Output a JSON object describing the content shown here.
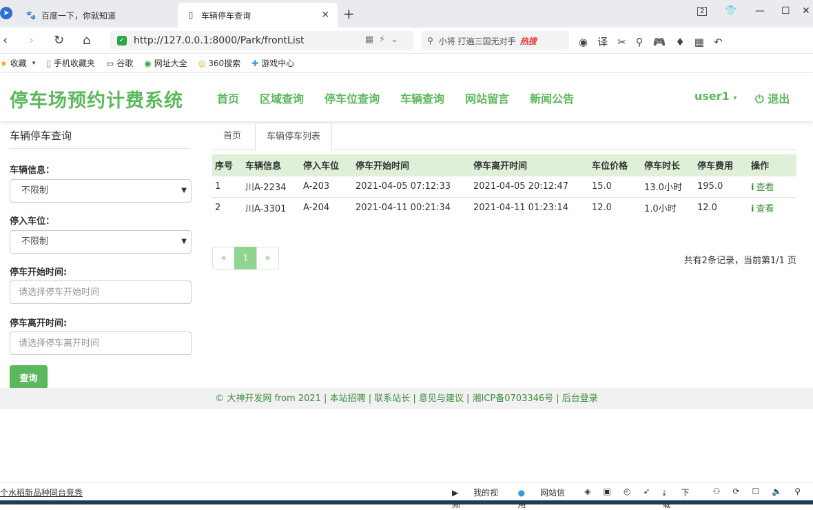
{
  "browser": {
    "tabs": [
      {
        "title": "百度一下，你就知道"
      },
      {
        "title": "车辆停车查询"
      }
    ],
    "url": "http://127.0.0.1:8000/Park/frontList",
    "search_placeholder": "小将 打遍三国无对手",
    "search_hot": "热搜",
    "window_badge": "2",
    "bookmarks": [
      {
        "label": "收藏",
        "icon": "star-icon"
      },
      {
        "label": "手机收藏夹",
        "icon": "phone-icon"
      },
      {
        "label": "谷歌",
        "icon": "page-icon"
      },
      {
        "label": "网址大全",
        "icon": "globe-icon"
      },
      {
        "label": "360搜索",
        "icon": "search-icon"
      },
      {
        "label": "游戏中心",
        "icon": "game-icon"
      }
    ]
  },
  "site": {
    "title": "停车场预约计费系统",
    "menu": [
      "首页",
      "区域查询",
      "停车位查询",
      "车辆查询",
      "网站留言",
      "新闻公告"
    ],
    "user": "user1",
    "logout": "退出"
  },
  "sidebar": {
    "title": "车辆停车查询",
    "vehicle_label": "车辆信息：",
    "vehicle_value": "不限制",
    "spot_label": "停入车位：",
    "spot_value": "不限制",
    "start_label": "停车开始时间:",
    "start_placeholder": "请选择停车开始时间",
    "end_label": "停车离开时间:",
    "end_placeholder": "请选择停车离开时间",
    "query_button": "查询"
  },
  "content": {
    "tab_home": "首页",
    "tab_active": "车辆停车列表",
    "columns": [
      "序号",
      "车辆信息",
      "停入车位",
      "停车开始时间",
      "停车离开时间",
      "车位价格",
      "停车时长",
      "停车费用",
      "操作"
    ],
    "rows": [
      {
        "no": "1",
        "vehicle": "川A-2234",
        "spot": "A-203",
        "start": "2021-04-05 07:12:33",
        "end": "2021-04-05 20:12:47",
        "price": "15.0",
        "duration": "13.0小时",
        "fee": "195.0",
        "action": "查看"
      },
      {
        "no": "2",
        "vehicle": "川A-3301",
        "spot": "A-204",
        "start": "2021-04-11 00:21:34",
        "end": "2021-04-11 01:23:14",
        "price": "12.0",
        "duration": "1.0小时",
        "fee": "12.0",
        "action": "查看"
      }
    ],
    "pager": {
      "prev": "«",
      "current": "1",
      "next": "»"
    },
    "page_info": "共有2条记录，当前第1/1 页"
  },
  "footer": {
    "text": "© 大神开发网 from 2021 | 本站招聘 | 联系站长 | 意见与建议 | 湘ICP备0703346号 | 后台登录"
  },
  "statusbar": {
    "news": "个水稻新品种同台竞秀",
    "my_video": "我的视频",
    "site_credit": "网站信用",
    "download": "下载"
  }
}
